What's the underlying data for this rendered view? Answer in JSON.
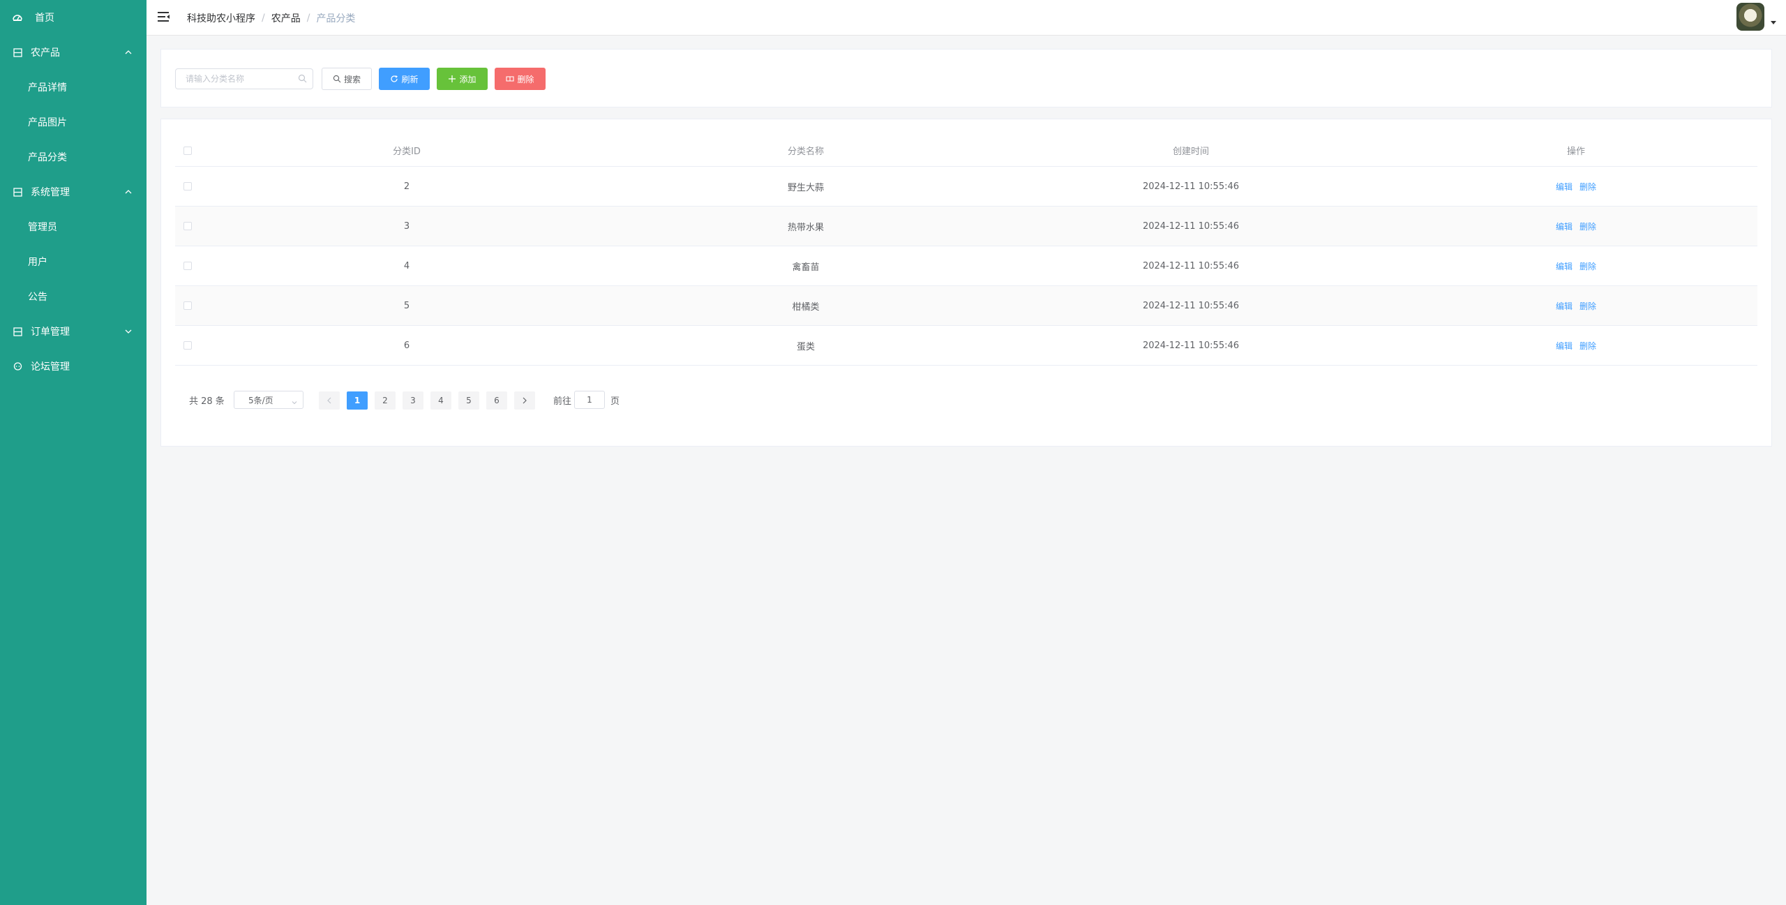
{
  "sidebar": {
    "items": [
      {
        "label": "首页",
        "icon": "dashboard-icon"
      },
      {
        "label": "农产品",
        "icon": "grid-icon",
        "expanded": true
      },
      {
        "label": "产品详情"
      },
      {
        "label": "产品图片"
      },
      {
        "label": "产品分类"
      },
      {
        "label": "系统管理",
        "icon": "grid-icon",
        "expanded": true
      },
      {
        "label": "管理员"
      },
      {
        "label": "用户"
      },
      {
        "label": "公告"
      },
      {
        "label": "订单管理",
        "icon": "grid-icon",
        "expanded": false
      },
      {
        "label": "论坛管理",
        "icon": "chat-icon"
      }
    ]
  },
  "header": {
    "breadcrumb": [
      "科技助农小程序",
      "农产品",
      "产品分类"
    ],
    "separator": "/"
  },
  "search": {
    "placeholder": "请输入分类名称",
    "value": "",
    "search_label": "搜索",
    "refresh_label": "刷新",
    "add_label": "添加",
    "delete_label": "删除"
  },
  "table": {
    "columns": [
      "分类ID",
      "分类名称",
      "创建时间",
      "操作"
    ],
    "rows": [
      {
        "id": "2",
        "name": "野生大蒜",
        "created": "2024-12-11 10:55:46"
      },
      {
        "id": "3",
        "name": "热带水果",
        "created": "2024-12-11 10:55:46"
      },
      {
        "id": "4",
        "name": "禽畜苗",
        "created": "2024-12-11 10:55:46"
      },
      {
        "id": "5",
        "name": "柑橘类",
        "created": "2024-12-11 10:55:46"
      },
      {
        "id": "6",
        "name": "蛋类",
        "created": "2024-12-11 10:55:46"
      }
    ],
    "edit_label": "编辑",
    "delete_label": "删除"
  },
  "pagination": {
    "total_text": "共 28 条",
    "page_size": "5条/页",
    "pages": [
      "1",
      "2",
      "3",
      "4",
      "5",
      "6"
    ],
    "current": "1",
    "goto_label": "前往",
    "goto_value": "1",
    "page_label": "页"
  },
  "colors": {
    "sidebar_bg": "#1f9e8a",
    "primary": "#409eff",
    "success": "#67c23a",
    "danger": "#f56c6c"
  }
}
